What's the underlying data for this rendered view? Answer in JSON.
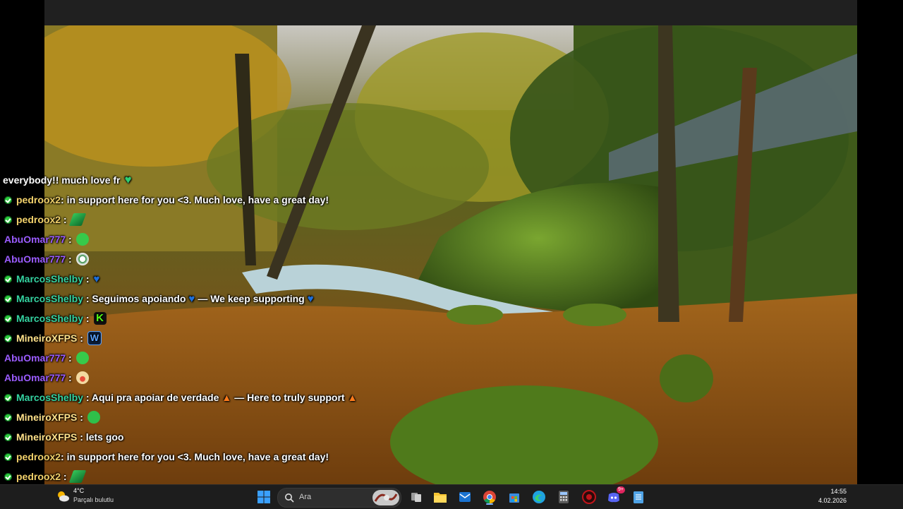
{
  "chat": {
    "truncated_line": "everybody!! much love fr",
    "messages": [
      {
        "user": "pedroox2",
        "color": "#f2d16b",
        "text": ": in support here for you <3. Much love, have a great day!",
        "emote": ""
      },
      {
        "user": "pedroox2",
        "color": "#f2d16b",
        "text": " :",
        "emote": "plant-emote"
      },
      {
        "user": "AbuOmar777",
        "color": "#9b5cff",
        "text": " :",
        "emote": "green-blob-emote"
      },
      {
        "user": "AbuOmar777",
        "color": "#9b5cff",
        "text": " :",
        "emote": "skull-emote"
      },
      {
        "user": "MarcosShelby",
        "color": "#34d3a1",
        "text": " :",
        "emote": "blue-heart-emote"
      },
      {
        "user": "MarcosShelby",
        "color": "#34d3a1",
        "text": " : Seguimos apoiando",
        "text2": "— We keep supporting",
        "emote": ""
      },
      {
        "user": "MarcosShelby",
        "color": "#34d3a1",
        "text": " :",
        "emote": "kick-logo-emote"
      },
      {
        "user": "MineiroXFPS",
        "color": "#ffe18a",
        "text": " :",
        "emote": "w-emote"
      },
      {
        "user": "AbuOmar777",
        "color": "#9b5cff",
        "text": " :",
        "emote": "green-blob-emote"
      },
      {
        "user": "AbuOmar777",
        "color": "#9b5cff",
        "text": " :",
        "emote": "face-emote"
      },
      {
        "user": "MarcosShelby",
        "color": "#34d3a1",
        "text": " : Aqui pra apoiar de verdade",
        "text2": "— Here to truly support",
        "emote": ""
      },
      {
        "user": "MineiroXFPS",
        "color": "#ffe18a",
        "text": " :",
        "emote": "green-face-emote"
      },
      {
        "user": "MineiroXFPS",
        "color": "#ffe18a",
        "text": " : lets goo",
        "emote": ""
      },
      {
        "user": "pedroox2",
        "color": "#f2d16b",
        "text": ": in support here for you <3. Much love, have a great day!",
        "emote": ""
      },
      {
        "user": "pedroox2",
        "color": "#f2d16b",
        "text": " :",
        "emote": "plant-emote"
      }
    ]
  },
  "taskbar": {
    "weather_temp": "4°C",
    "weather_desc": "Parçalı bulutlu",
    "search_placeholder": "Ara",
    "clock_time": "14:55",
    "clock_date": "4.02.2026",
    "discord_badge": "9+",
    "apps": [
      "start",
      "search",
      "task-view",
      "file-explorer",
      "outlook",
      "chrome",
      "microsoft-store",
      "edge",
      "calculator",
      "obs",
      "discord",
      "notepad"
    ]
  }
}
